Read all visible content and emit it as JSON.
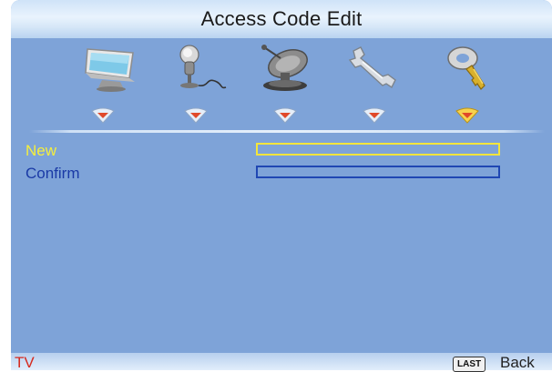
{
  "header": {
    "title": "Access Code Edit"
  },
  "menu": {
    "icons": [
      {
        "name": "picture-monitor-icon"
      },
      {
        "name": "audio-microphone-icon"
      },
      {
        "name": "channel-satellite-icon"
      },
      {
        "name": "setup-wrench-icon"
      },
      {
        "name": "lock-key-icon",
        "selected": true
      }
    ]
  },
  "form": {
    "new_label": "New",
    "new_value": "",
    "confirm_label": "Confirm",
    "confirm_value": ""
  },
  "footer": {
    "source": "TV",
    "last_key": "LAST",
    "back_label": "Back"
  },
  "colors": {
    "screen_bg": "#7ea3d8",
    "active_label": "#f6ef3c",
    "inactive_label": "#1a3aa6",
    "source_text": "#d62a1e"
  }
}
